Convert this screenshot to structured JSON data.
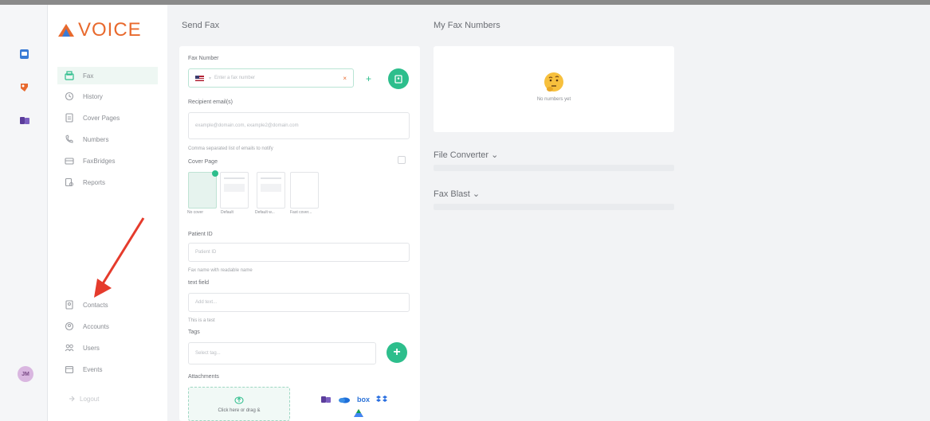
{
  "brand": {
    "name": "VOICE",
    "accent": "#e8692d",
    "green": "#2dbe8c"
  },
  "rail": {
    "apps": [
      {
        "icon": "voice-app-icon",
        "color": "#3a7bd5"
      },
      {
        "icon": "fax-app-icon",
        "color": "#e8692d"
      },
      {
        "icon": "chat-app-icon",
        "color": "#5b3d9b"
      }
    ],
    "avatar_initials": "JM"
  },
  "sidebar": {
    "items": [
      {
        "label": "Fax",
        "icon": "fax-icon",
        "active": true
      },
      {
        "label": "History",
        "icon": "history-icon"
      },
      {
        "label": "Cover Pages",
        "icon": "cover-pages-icon"
      },
      {
        "label": "Numbers",
        "icon": "phone-icon"
      },
      {
        "label": "FaxBridges",
        "icon": "fax-bridge-icon"
      },
      {
        "label": "Reports",
        "icon": "reports-icon"
      }
    ],
    "bottom_items": [
      {
        "label": "Contacts",
        "icon": "contacts-icon"
      },
      {
        "label": "Accounts",
        "icon": "accounts-icon"
      },
      {
        "label": "Users",
        "icon": "users-icon"
      },
      {
        "label": "Events",
        "icon": "events-icon"
      }
    ],
    "logout_label": "Logout"
  },
  "send_fax": {
    "title": "Send Fax",
    "fax_number_label": "Fax Number",
    "fax_number_placeholder": "Enter a fax number",
    "country": "US",
    "recipient_label": "Recipient email(s)",
    "recipient_placeholder": "example@domain.com, example2@domain.com",
    "recipient_hint": "Comma separated list of emails to notify",
    "cover_page_label": "Cover Page",
    "covers": [
      "No cover",
      "Default",
      "Default w...",
      "Fast cover..."
    ],
    "patient_id_label": "Patient ID",
    "patient_id_placeholder": "Patient ID",
    "patient_id_hint": "Fax name with readable name",
    "text_field_label": "text field",
    "text_field_placeholder": "Add text...",
    "text_field_hint": "This is a test",
    "tags_label": "Tags",
    "tags_placeholder": "Select tag...",
    "attachments_label": "Attachments",
    "upload_text": "Click here or drag &"
  },
  "my_fax_numbers": {
    "title": "My Fax Numbers",
    "empty_text": "No numbers yet"
  },
  "file_converter": {
    "title": "File Converter ⌄"
  },
  "fax_blast": {
    "title": "Fax Blast ⌄"
  },
  "cloud_sources": [
    "teams",
    "onedrive",
    "box",
    "dropbox",
    "google-drive"
  ]
}
